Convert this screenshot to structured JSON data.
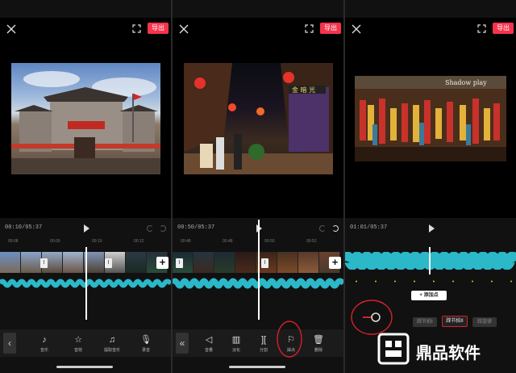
{
  "panels": [
    {
      "export_label": "导出",
      "time": "00:10/05:37",
      "ruler": [
        "00:08",
        "00:09",
        "00:10",
        "00:12"
      ],
      "tools": [
        {
          "icon": "music-icon",
          "glyph": "♪",
          "label": "音乐"
        },
        {
          "icon": "sound-effect-icon",
          "glyph": "☆",
          "label": "音效"
        },
        {
          "icon": "tiktok-icon",
          "glyph": "♫",
          "label": "提取音乐"
        },
        {
          "icon": "microphone-icon",
          "glyph": "🎙",
          "label": "录音"
        }
      ]
    },
    {
      "export_label": "导出",
      "time": "00:50/05:37",
      "ruler": [
        "00:48",
        "00:48",
        "00:50",
        "00:52"
      ],
      "tools": [
        {
          "icon": "volume-icon",
          "glyph": "◁",
          "label": "音量"
        },
        {
          "icon": "fade-icon",
          "glyph": "▥",
          "label": "淡化"
        },
        {
          "icon": "split-icon",
          "glyph": "][",
          "label": "分割"
        },
        {
          "icon": "beat-flag-icon",
          "glyph": "⚐",
          "label": "踩点"
        },
        {
          "icon": "delete-icon",
          "glyph": "🗑",
          "label": "删除"
        }
      ]
    },
    {
      "export_label": "导出",
      "time": "01:01/05:37",
      "sign_text": "Shadow play",
      "add_point_label": "+ 添加点",
      "beat_buttons": [
        "踩节拍I",
        "踩节拍II",
        "踩旋律"
      ]
    }
  ],
  "logo": {
    "text": "鼎品软件"
  },
  "colors": {
    "accent": "#f5344c",
    "wave": "#2bb8c9",
    "annotation": "#d6202a"
  }
}
